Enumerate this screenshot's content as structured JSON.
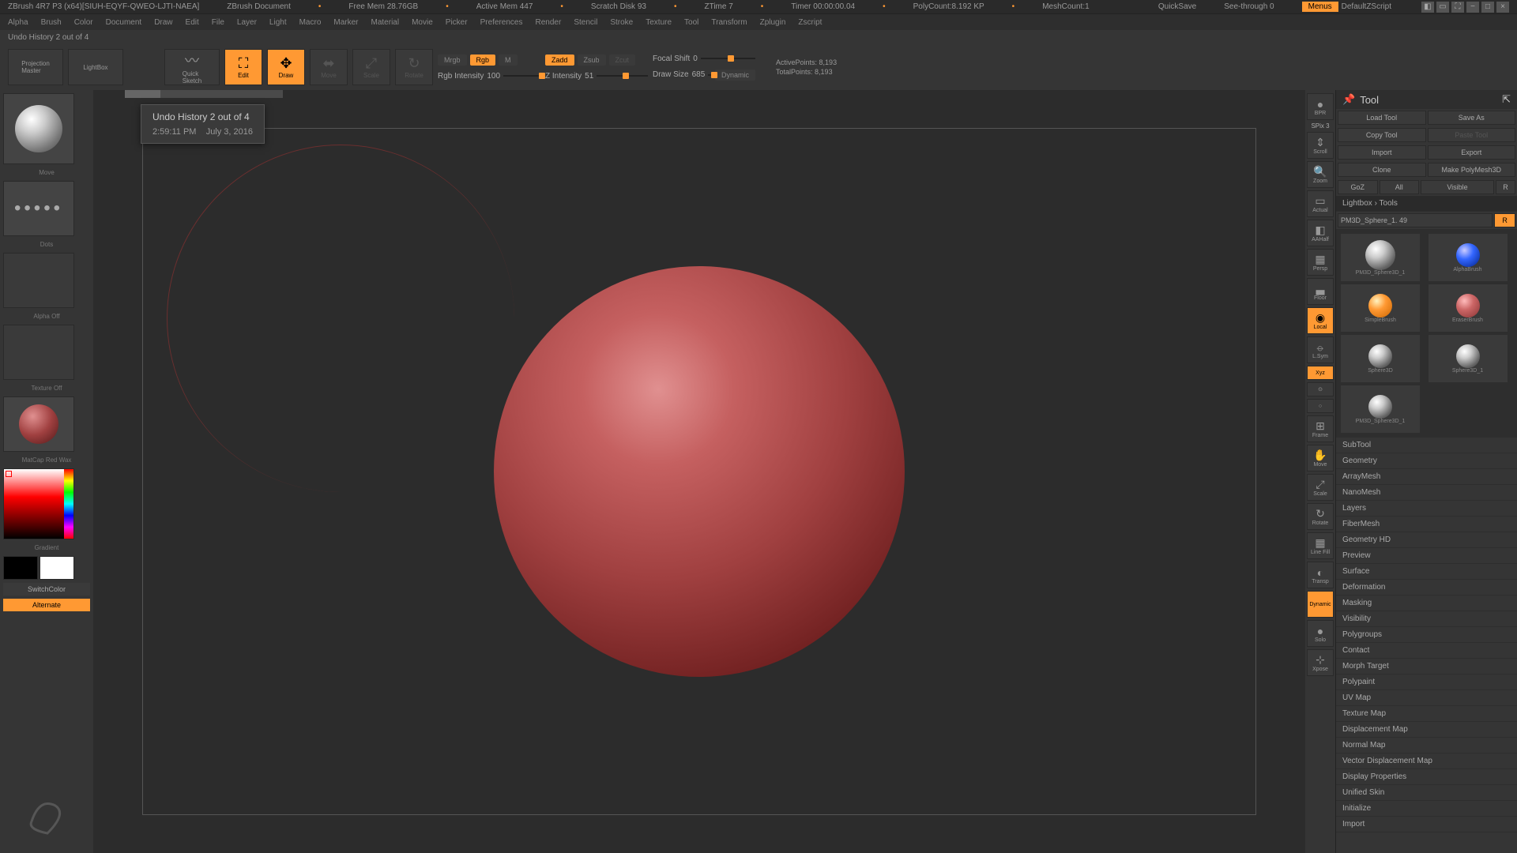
{
  "titlebar": {
    "app": "ZBrush 4R7 P3 (x64)[SIUH-EQYF-QWEO-LJTI-NAEA]",
    "doc": "ZBrush Document",
    "freemem": "Free Mem 28.76GB",
    "activemem": "Active Mem 447",
    "scratch": "Scratch Disk 93",
    "ztime": "ZTime 7",
    "timer": "Timer 00:00:00.04",
    "polycount": "PolyCount:8.192 KP",
    "meshcount": "MeshCount:1",
    "quicksave": "QuickSave",
    "seethrough": "See-through   0",
    "menus": "Menus",
    "defaultscript": "DefaultZScript"
  },
  "menubar": {
    "items": [
      "Alpha",
      "Brush",
      "Color",
      "Document",
      "Draw",
      "Edit",
      "File",
      "Layer",
      "Light",
      "Macro",
      "Marker",
      "Material",
      "Movie",
      "Picker",
      "Preferences",
      "Render",
      "Stencil",
      "Stroke",
      "Texture",
      "Tool",
      "Transform",
      "Zplugin",
      "Zscript"
    ]
  },
  "status": {
    "text": "Undo History 2 out of 4"
  },
  "toolbar": {
    "projection": "Projection\nMaster",
    "lightbox": "LightBox",
    "quicksketch": "Quick\nSketch",
    "edit": "Edit",
    "draw": "Draw",
    "move": "Move",
    "scale": "Scale",
    "rotate": "Rotate",
    "mrgb": "Mrgb",
    "rgb": "Rgb",
    "m": "M",
    "rgbint_label": "Rgb Intensity",
    "rgbint_val": "100",
    "zadd": "Zadd",
    "zsub": "Zsub",
    "zcut": "Zcut",
    "zint_label": "Z Intensity",
    "zint_val": "51",
    "focal_label": "Focal Shift",
    "focal_val": "0",
    "drawsize_label": "Draw Size",
    "drawsize_val": "685",
    "dynamic": "Dynamic",
    "active_label": "ActivePoints:",
    "active_val": "8,193",
    "total_label": "TotalPoints:",
    "total_val": "8,193"
  },
  "left": {
    "brush_label": "Move",
    "stroke_label": "Dots",
    "alpha_label": "Alpha Off",
    "texture_label": "Texture Off",
    "material_label": "MatCap Red Wax",
    "gradient": "Gradient",
    "switchcolor": "SwitchColor",
    "alternate": "Alternate"
  },
  "tooltip": {
    "title": "Undo History 2 out of 4",
    "time": "2:59:11 PM",
    "date": "July 3, 2016"
  },
  "rightdock": {
    "items": [
      "BPR",
      "Scroll",
      "Zoom",
      "Actual",
      "AAHalf",
      "Persp",
      "Floor",
      "Local",
      "L.Sym",
      "Xyz",
      "",
      "",
      "Frame",
      "Move",
      "Scale",
      "Rotate",
      "Line Fill",
      "Transp",
      "Dynamic",
      "Solo",
      "Xpose"
    ],
    "spix": "SPix 3"
  },
  "toolpanel": {
    "title": "Tool",
    "btns": {
      "load": "Load Tool",
      "save": "Save As",
      "copy": "Copy Tool",
      "paste": "Paste Tool",
      "import": "Import",
      "export": "Export",
      "clone": "Clone",
      "makepoly": "Make PolyMesh3D",
      "goz": "GoZ",
      "all": "All",
      "visible": "Visible",
      "r": "R"
    },
    "lightbox_tools": "Lightbox › Tools",
    "current": "PM3D_Sphere_1. 49",
    "r2": "R",
    "thumbs": [
      "PM3D_Sphere3D_1",
      "AlphaBrush",
      "SimpleBrush",
      "EraserBrush",
      "Sphere3D",
      "Sphere3D_1",
      "PM3D_Sphere3D_1"
    ],
    "sections": [
      "SubTool",
      "Geometry",
      "ArrayMesh",
      "NanoMesh",
      "Layers",
      "FiberMesh",
      "Geometry HD",
      "Preview",
      "Surface",
      "Deformation",
      "Masking",
      "Visibility",
      "Polygroups",
      "Contact",
      "Morph Target",
      "Polypaint",
      "UV Map",
      "Texture Map",
      "Displacement Map",
      "Normal Map",
      "Vector Displacement Map",
      "Display Properties",
      "Unified Skin",
      "Initialize",
      "Import"
    ]
  }
}
